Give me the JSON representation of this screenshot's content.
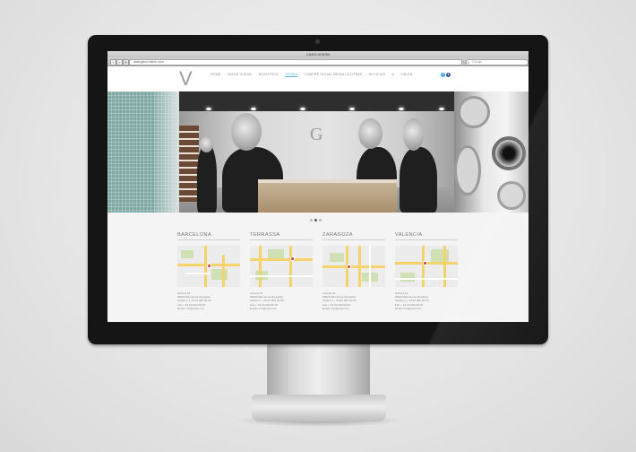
{
  "browser": {
    "window_title": "CASO-VISION",
    "url": "www.gaxo-vision.com",
    "search_placeholder": "Google"
  },
  "site": {
    "logo": "V",
    "menu": [
      {
        "label": "HOME",
        "active": false
      },
      {
        "label": "SALUD VISUAL",
        "active": false
      },
      {
        "label": "NOSOTROS",
        "active": false
      },
      {
        "label": "TIENDA",
        "active": true
      },
      {
        "label": "COMPRE OCHAL MEDALLA OTRAS",
        "active": false
      },
      {
        "label": "NOTICIAS",
        "active": false
      },
      {
        "label": "Q",
        "active": false
      },
      {
        "label": "VISION",
        "active": false
      }
    ],
    "social": [
      {
        "name": "twitter-icon",
        "glyph": "t",
        "color": "#3aa4d8"
      },
      {
        "name": "facebook-icon",
        "glyph": "f",
        "color": "#3b5a9a"
      }
    ]
  },
  "hero": {
    "sign_text": "G",
    "slide_dots": [
      false,
      true,
      false
    ]
  },
  "locations": [
    {
      "city": "BARCELONA",
      "address": [
        "C/Paris 61",
        "08029 Barcelona (España)",
        "Teléfono + 34 93 000 00 00",
        "Fax + 34 93 000 00 00",
        "Email: info@vision.es"
      ]
    },
    {
      "city": "TERRASSA",
      "address": [
        "C/Paris 61",
        "08029 Barcelona (España)",
        "Teléfono + 34 93 000 00 00",
        "Fax + 34 93 000 00 00",
        "Email: info@vision.es"
      ]
    },
    {
      "city": "ZARAGOZA",
      "address": [
        "C/Paris 61",
        "08029 Barcelona (España)",
        "Teléfono + 34 93 000 00 00",
        "Fax + 34 93 000 00 00",
        "Email: info@vision.es"
      ]
    },
    {
      "city": "VALENCIA",
      "address": [
        "C/Paris 61",
        "08029 Barcelona (España)",
        "Teléfono + 34 93 000 00 00",
        "Fax + 34 93 000 00 00",
        "Email: info@vision.es"
      ]
    }
  ],
  "colors": {
    "accent": "#5bb3d8",
    "map_road": "#f4d36a",
    "map_park": "#cfe0b4",
    "map_pin": "#d23b3b"
  }
}
